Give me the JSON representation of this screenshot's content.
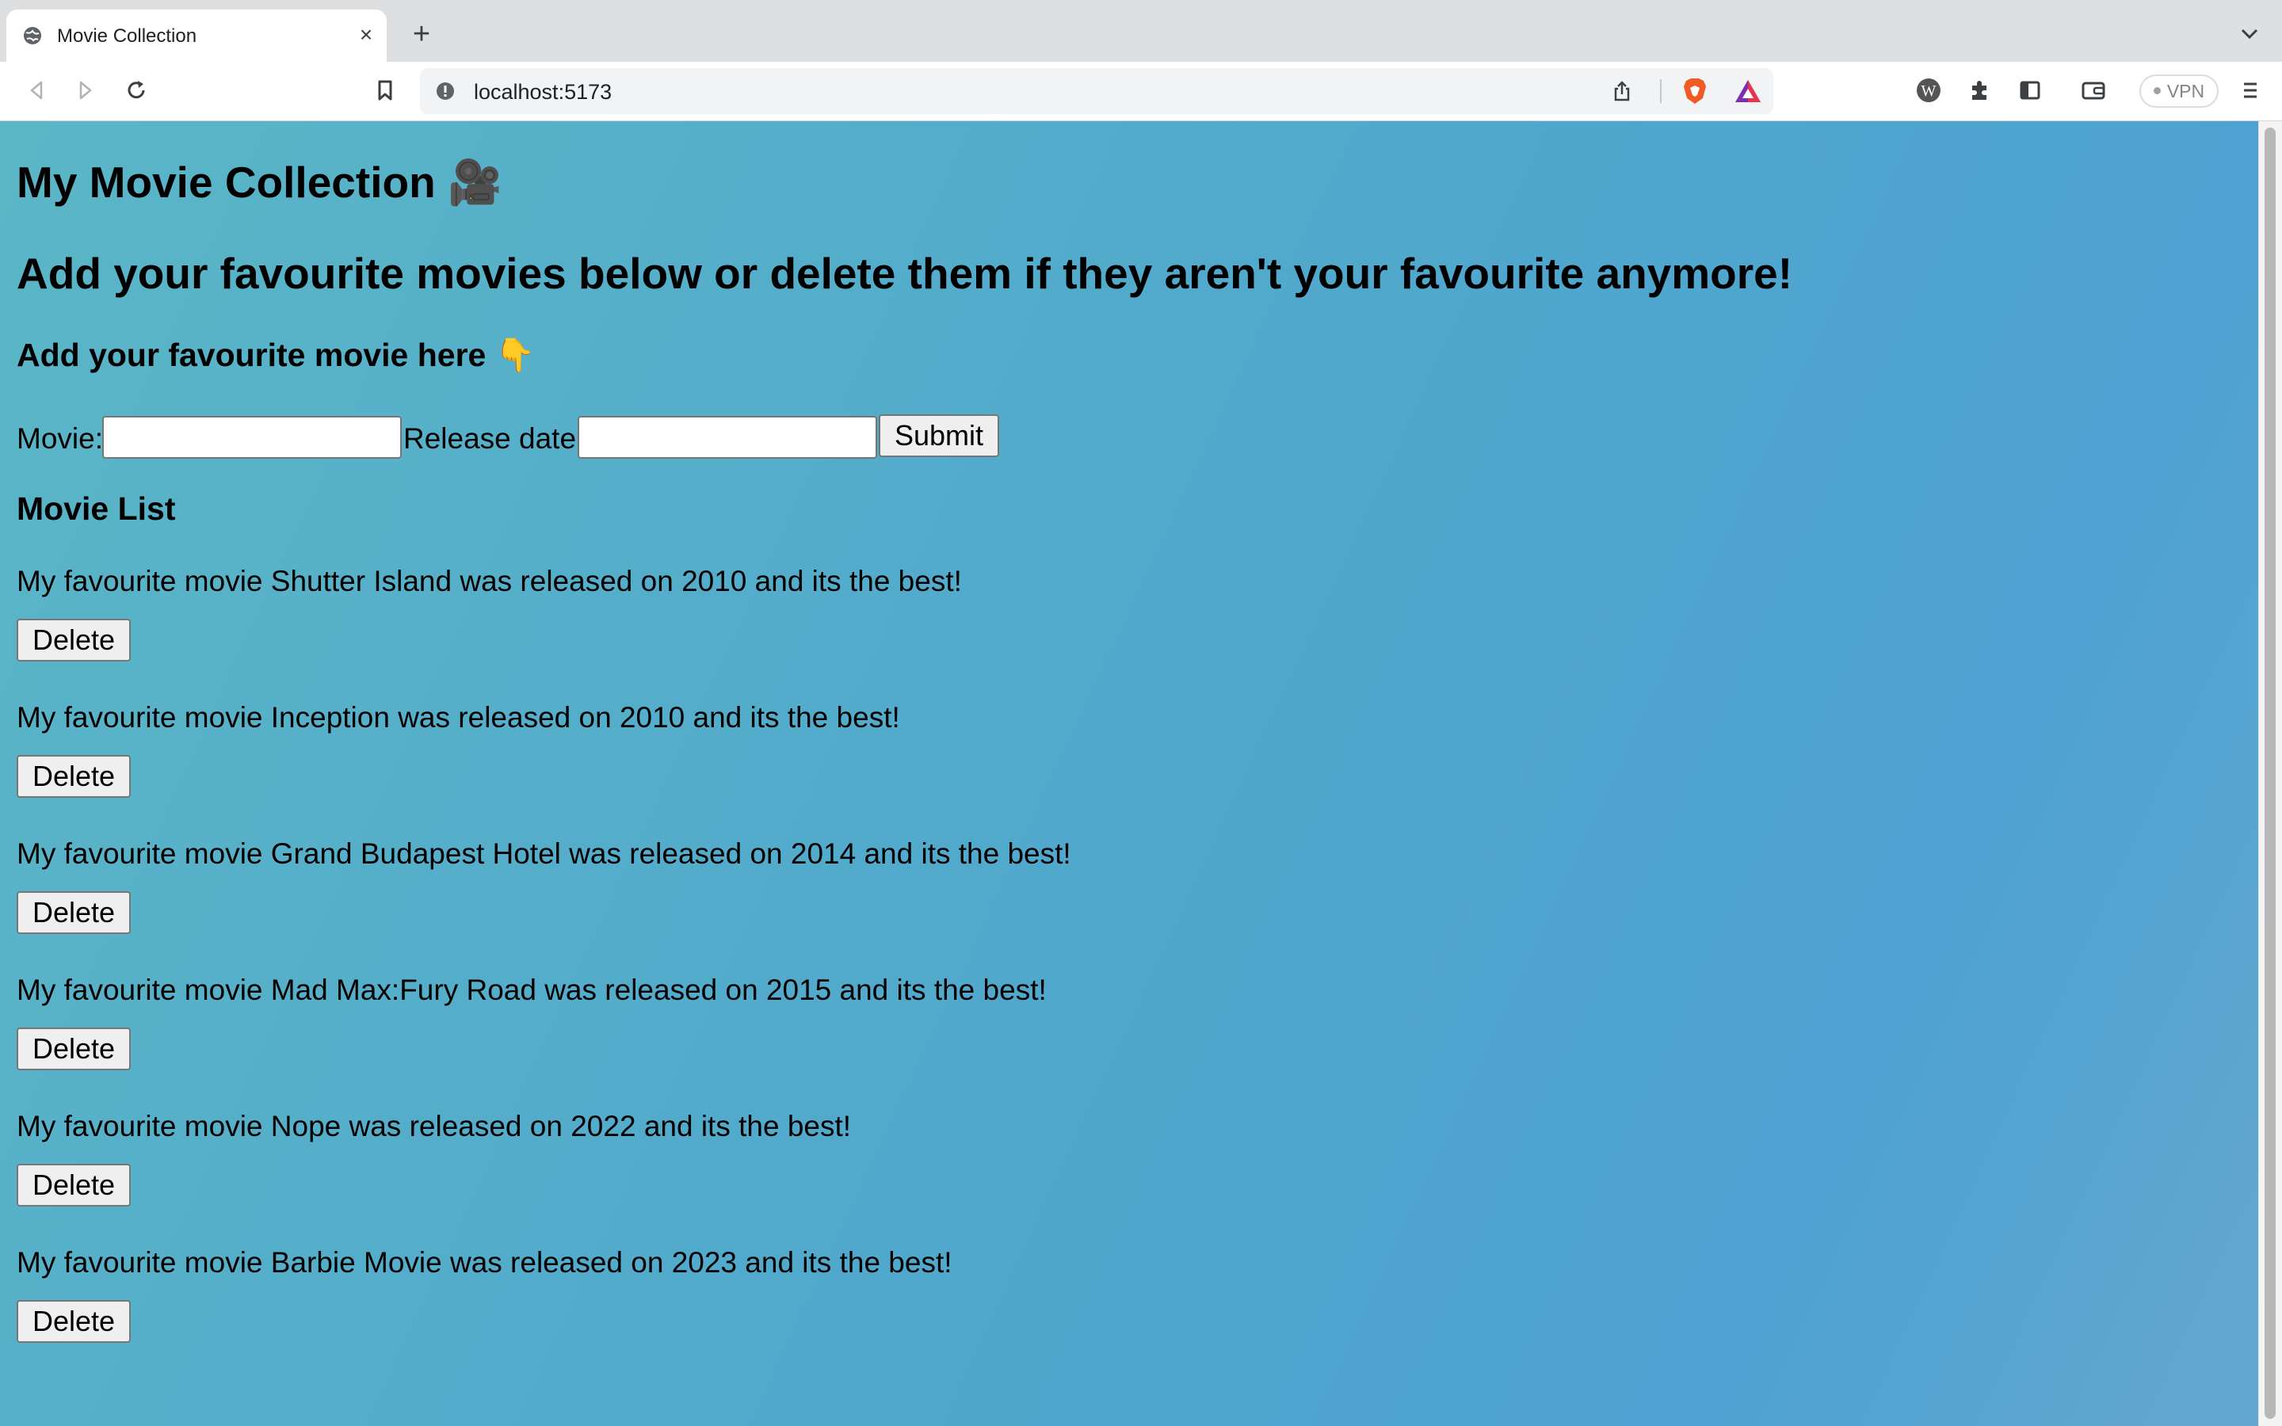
{
  "browser": {
    "tab_title": "Movie Collection",
    "url": "localhost:5173",
    "vpn_label": "VPN"
  },
  "page": {
    "title": "My Movie Collection 🎥",
    "subtitle": "Add your favourite movies below or delete them if they aren't your favourite anymore!",
    "form_heading": "Add your favourite movie here 👇",
    "form": {
      "movie_label": "Movie:",
      "movie_value": "",
      "release_label": "Release date:",
      "release_value": "",
      "submit_label": "Submit"
    },
    "list_heading": "Movie List",
    "delete_label": "Delete",
    "movies": [
      "My favourite movie Shutter Island was released on 2010 and its the best!",
      "My favourite movie Inception was released on 2010 and its the best!",
      "My favourite movie Grand Budapest Hotel was released on 2014 and its the best!",
      "My favourite movie Mad Max:Fury Road was released on 2015 and its the best!",
      "My favourite movie Nope was released on 2022 and its the best!",
      "My favourite movie Barbie Movie was released on 2023 and its the best!"
    ]
  },
  "colors": {
    "page_gradient_start": "#5bb6c6",
    "page_gradient_end": "#4ea2d1",
    "brave_orange": "#f05a24"
  }
}
